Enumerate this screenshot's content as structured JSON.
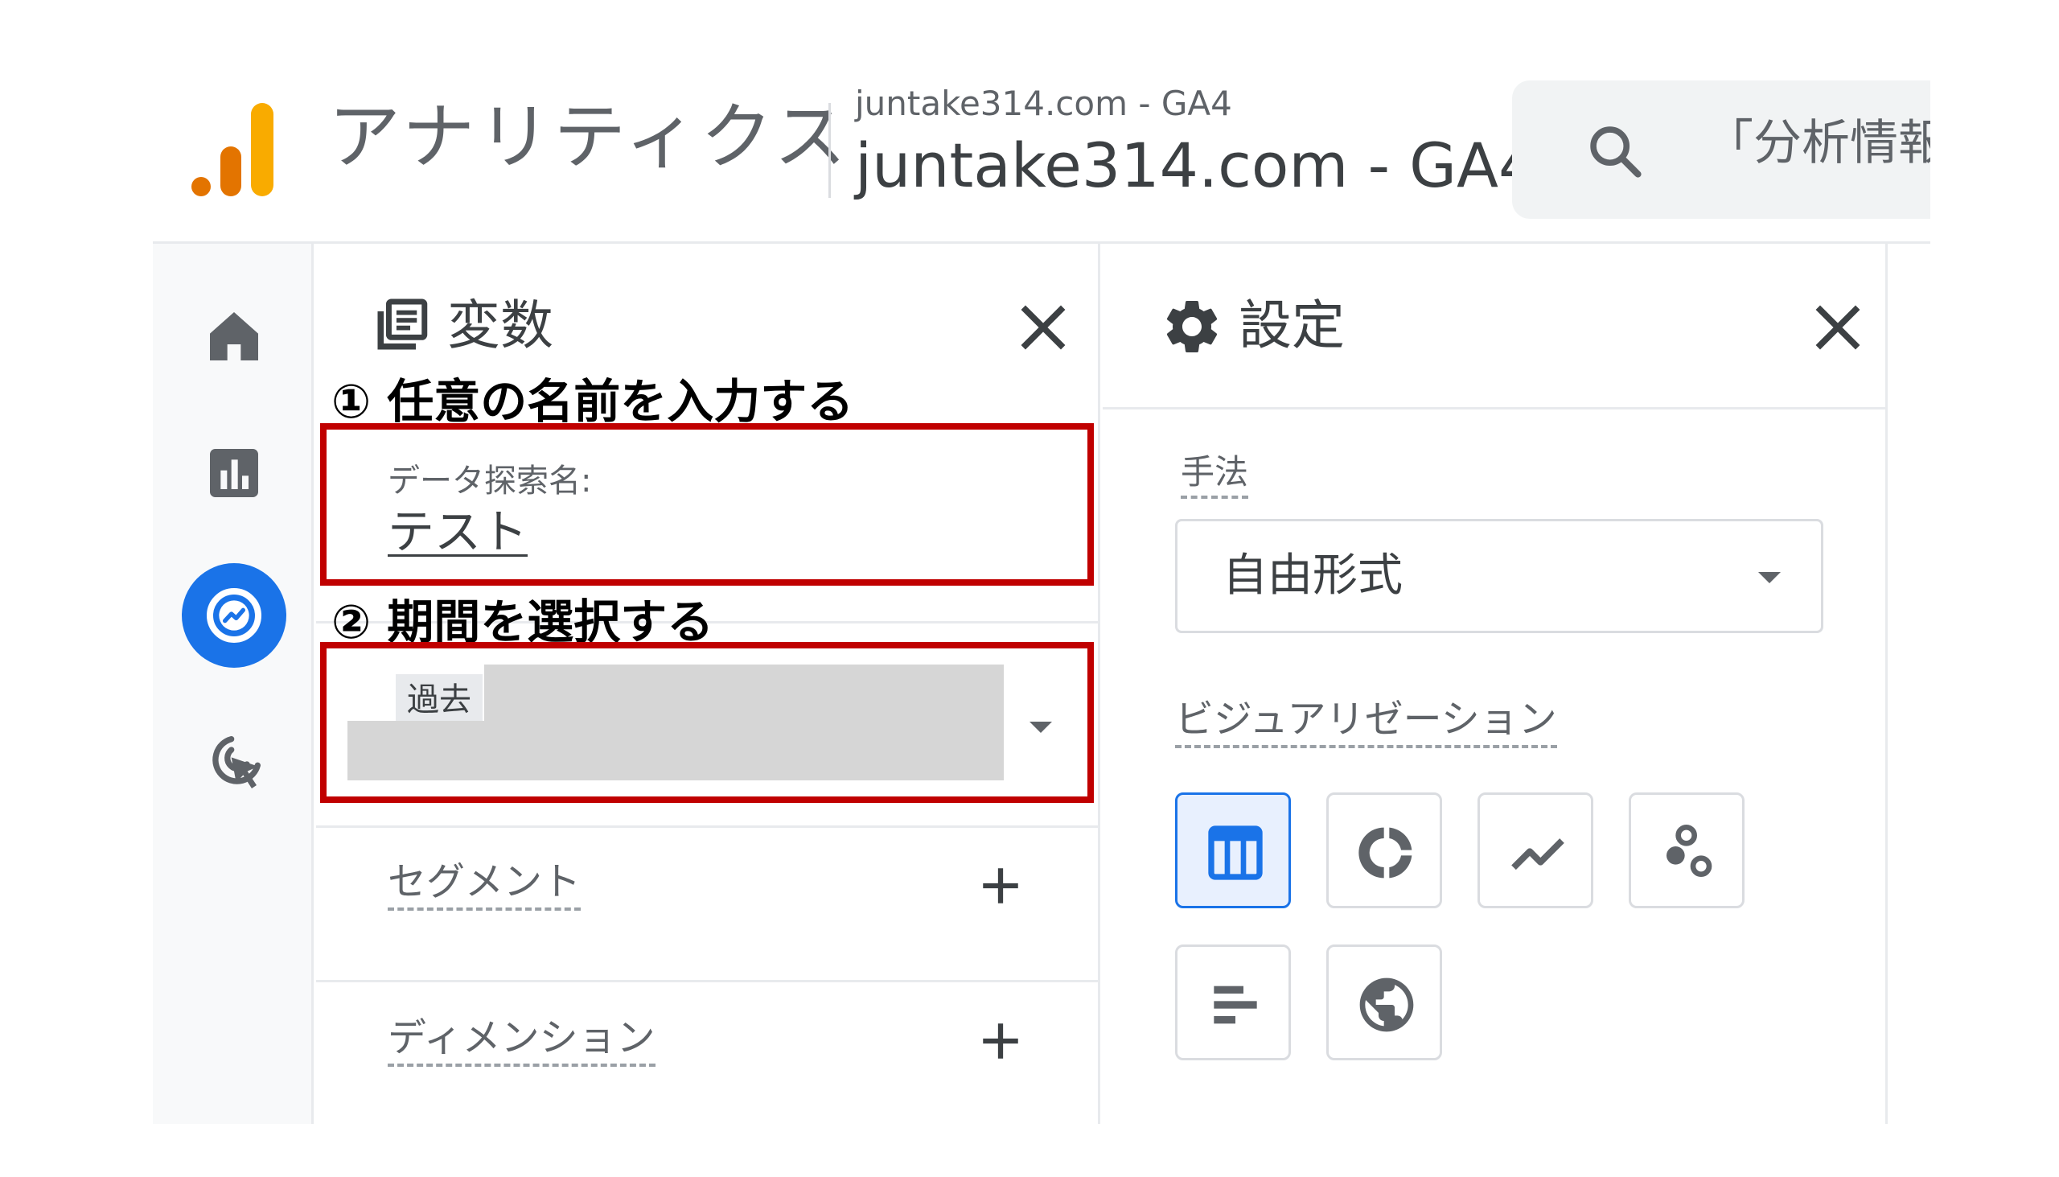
{
  "header": {
    "app_name": "アナリティクス",
    "account_small": "juntake314.com - GA4",
    "account_big": "juntake314.com - GA4",
    "search_placeholder": "「分析情報"
  },
  "rail": {
    "items": [
      "home-icon",
      "reports-icon",
      "explore-icon",
      "advertising-icon"
    ],
    "active": "explore-icon"
  },
  "variables_panel": {
    "title": "変数",
    "annotation_1": "① 任意の名前を入力する",
    "name_label": "データ探索名:",
    "name_value": "テスト",
    "annotation_2": "② 期間を選択する",
    "date_chip": "過去",
    "segments_label": "セグメント",
    "dimensions_label": "ディメンション"
  },
  "settings_panel": {
    "title": "設定",
    "technique_label": "手法",
    "technique_value": "自由形式",
    "visualization_label": "ビジュアリゼーション",
    "visualizations": [
      "table-icon",
      "donut-chart-icon",
      "line-chart-icon",
      "scatter-plot-icon",
      "bar-chart-icon",
      "geo-map-icon"
    ],
    "active_visualization": "table-icon"
  },
  "colors": {
    "accent": "#1a73e8",
    "annotation_box": "#c00000",
    "logo_orange": "#f9ab00",
    "logo_dark_orange": "#e37400"
  }
}
